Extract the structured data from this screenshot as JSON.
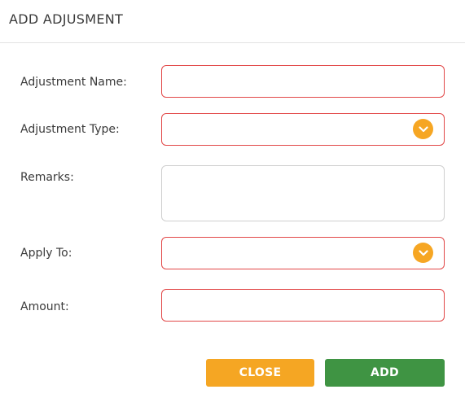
{
  "dialog": {
    "title": "ADD ADJUSMENT"
  },
  "form": {
    "adjustment_name": {
      "label": "Adjustment Name:",
      "value": ""
    },
    "adjustment_type": {
      "label": "Adjustment Type:",
      "value": ""
    },
    "remarks": {
      "label": "Remarks:",
      "value": ""
    },
    "apply_to": {
      "label": "Apply To:",
      "value": ""
    },
    "amount": {
      "label": "Amount:",
      "value": ""
    }
  },
  "buttons": {
    "close_label": "CLOSE",
    "add_label": "ADD"
  },
  "colors": {
    "required_border": "#e24848",
    "accent_orange": "#f5a623",
    "add_green": "#3f9443"
  },
  "icons": {
    "dropdown": "chevron-down-icon"
  }
}
